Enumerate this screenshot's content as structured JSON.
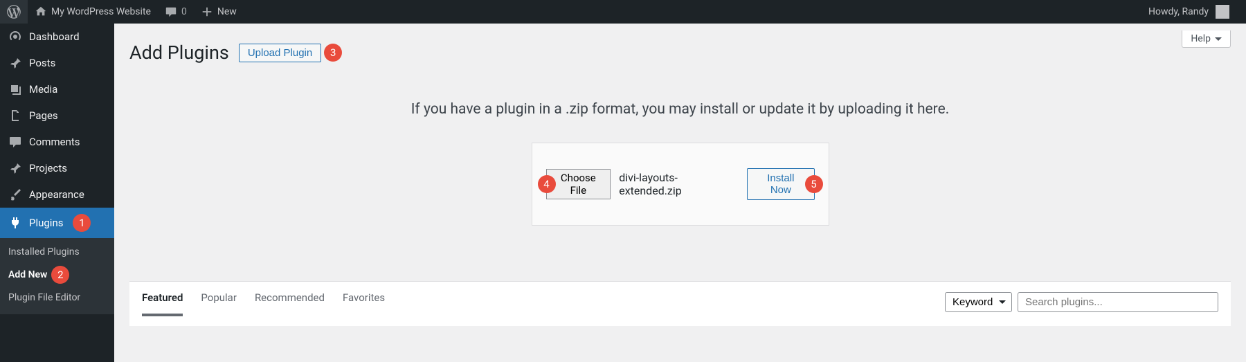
{
  "adminbar": {
    "site_name": "My WordPress Website",
    "comment_count": "0",
    "new_label": "New",
    "greeting": "Howdy, Randy"
  },
  "sidebar": {
    "dashboard": "Dashboard",
    "posts": "Posts",
    "media": "Media",
    "pages": "Pages",
    "comments": "Comments",
    "projects": "Projects",
    "appearance": "Appearance",
    "plugins": "Plugins",
    "sub_installed": "Installed Plugins",
    "sub_addnew": "Add New",
    "sub_editor": "Plugin File Editor"
  },
  "main": {
    "help_label": "Help",
    "page_title": "Add Plugins",
    "upload_btn": "Upload Plugin",
    "upload_help": "If you have a plugin in a .zip format, you may install or update it by uploading it here.",
    "choose_file": "Choose File",
    "file_name": "divi-layouts-extended.zip",
    "install_now": "Install Now",
    "filter_tabs": {
      "featured": "Featured",
      "popular": "Popular",
      "recommended": "Recommended",
      "favorites": "Favorites"
    },
    "type_select": "Keyword",
    "search_placeholder": "Search plugins..."
  },
  "annotations": {
    "b1": "1",
    "b2": "2",
    "b3": "3",
    "b4": "4",
    "b5": "5"
  }
}
